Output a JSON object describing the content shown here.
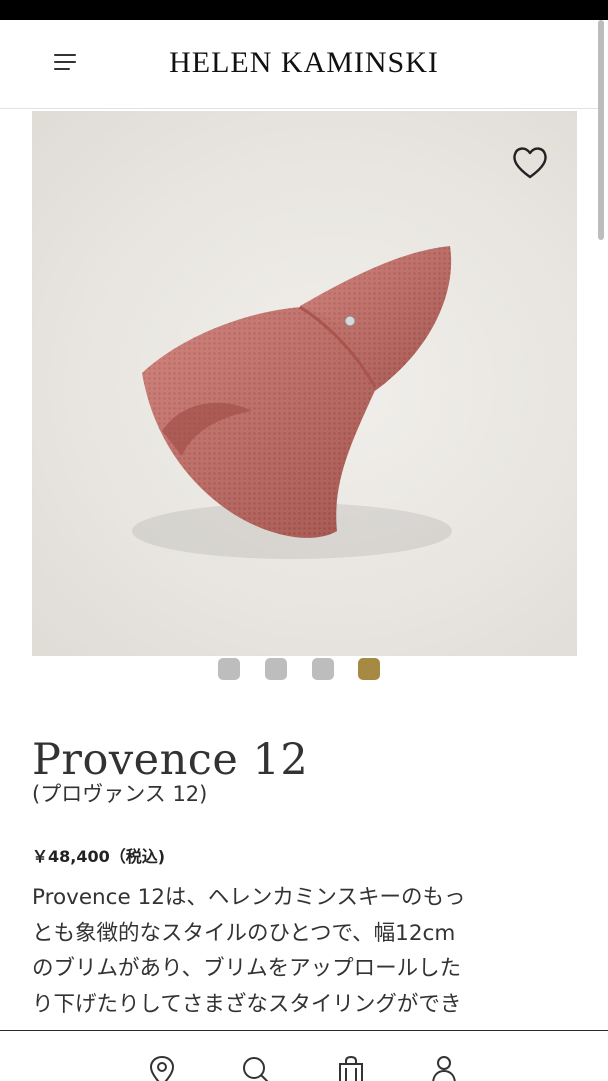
{
  "header": {
    "brand": "HELEN KAMINSKI",
    "menu_icon": "hamburger-menu-icon"
  },
  "product": {
    "image_description_icon": "wishlist-heart-icon",
    "carousel": {
      "total": 4,
      "active_index": 3,
      "active_color": "#a68a43",
      "inactive_color": "#bdbdbd"
    },
    "name": "Provence 12",
    "subtitle": "(プロヴァンス 12)",
    "price": "￥48,400（税込)",
    "description_lines": [
      "Provence 12は、ヘレンカミンスキーのもっ",
      "とも象徴的なスタイルのひとつで、幅12cm",
      "のブリムがあり、ブリムをアップロールした",
      "り下げたりしてさまざなスタイリングができ"
    ]
  },
  "bottom_nav": {
    "items": [
      {
        "icon": "location-pin-icon"
      },
      {
        "icon": "search-icon"
      },
      {
        "icon": "shopping-bag-icon"
      },
      {
        "icon": "account-icon"
      }
    ]
  }
}
